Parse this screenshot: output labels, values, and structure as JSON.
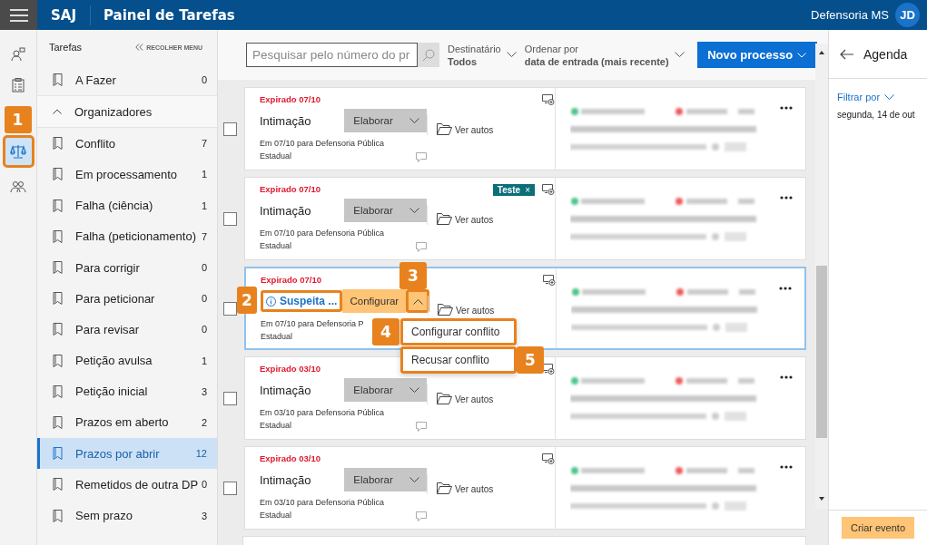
{
  "header": {
    "brand": "SAJ",
    "title": "Painel de Tarefas",
    "user": "Defensoria MS",
    "avatar": "JD"
  },
  "rail": [
    {
      "selected": false
    },
    {
      "selected": false
    },
    {
      "selected": true,
      "callout": "1"
    },
    {
      "selected": false
    }
  ],
  "sidebar": {
    "title": "Tarefas",
    "collapse": "RECOLHER MENU",
    "items": [
      {
        "label": "A Fazer",
        "count": "0",
        "selected": false
      }
    ],
    "group": {
      "label": "Organizadores",
      "expanded": true,
      "children": [
        {
          "label": "Conflito",
          "count": "7",
          "selected": false
        },
        {
          "label": "Em processamento",
          "count": "1",
          "selected": false
        },
        {
          "label": "Falha (ciência)",
          "count": "1",
          "selected": false
        },
        {
          "label": "Falha (peticionamento)",
          "count": "7",
          "selected": false
        },
        {
          "label": "Para corrigir",
          "count": "0",
          "selected": false
        },
        {
          "label": "Para peticionar",
          "count": "0",
          "selected": false
        },
        {
          "label": "Para revisar",
          "count": "0",
          "selected": false
        },
        {
          "label": "Petição avulsa",
          "count": "1",
          "selected": false
        },
        {
          "label": "Petição inicial",
          "count": "3",
          "selected": false
        },
        {
          "label": "Prazos em aberto",
          "count": "2",
          "selected": false
        },
        {
          "label": "Prazos por abrir",
          "count": "12",
          "selected": true
        },
        {
          "label": "Remetidos de outra DP",
          "count": "0",
          "selected": false
        },
        {
          "label": "Sem prazo",
          "count": "3",
          "selected": false
        }
      ]
    }
  },
  "toolbar": {
    "search": {
      "placeholder": "Pesquisar pelo número do pr"
    },
    "filters": [
      {
        "label": "Destinatário",
        "value": "Todos"
      },
      {
        "label": "Ordenar por",
        "value": "data de entrada (mais recente)"
      }
    ],
    "new_button": "Novo processo"
  },
  "tasks": [
    {
      "kind": "normal",
      "deadline": "Expirado 07/10",
      "type": "Intimação",
      "action": "Elaborar",
      "note": [
        "Em 07/10 para Defensoria Pública",
        "Estadual"
      ],
      "files": "Ver autos",
      "selected": false,
      "checked": false
    },
    {
      "kind": "normal",
      "deadline": "Expirado 07/10",
      "type": "Intimação",
      "action": "Elaborar",
      "note": [
        "Em 07/10 para Defensoria Pública",
        "Estadual"
      ],
      "files": "Ver autos",
      "tags": [
        {
          "label": "Teste",
          "remove": "×"
        }
      ],
      "selected": false,
      "checked": false
    },
    {
      "kind": "conflict",
      "deadline": "Expirado 07/10",
      "type": "Suspeita ...",
      "type_callout": "2",
      "action": "Configurar",
      "caret_callout": "3",
      "note": [
        "Em 07/10 para Defensoria P",
        "Estadual"
      ],
      "files": "Ver autos",
      "selected": true,
      "checked": false,
      "menu": [
        {
          "label": "Configurar conflito",
          "callout": "4"
        },
        {
          "label": "Recusar conflito",
          "callout": "5"
        }
      ]
    },
    {
      "kind": "normal",
      "deadline": "Expirado 03/10",
      "type": "Intimação",
      "action": "Elaborar",
      "note": [
        "Em 03/10 para Defensoria Pública",
        "Estadual"
      ],
      "files": "Ver autos",
      "selected": false,
      "checked": false
    },
    {
      "kind": "normal",
      "deadline": "Expirado 03/10",
      "type": "Intimação",
      "action": "Elaborar",
      "note": [
        "Em 03/10 para Defensoria Pública",
        "Estadual"
      ],
      "files": "Ver autos",
      "selected": false,
      "checked": false
    }
  ],
  "agenda": {
    "title": "Agenda",
    "filter": "Filtrar por",
    "date": "segunda, 14 de out",
    "create": "Criar evento"
  }
}
